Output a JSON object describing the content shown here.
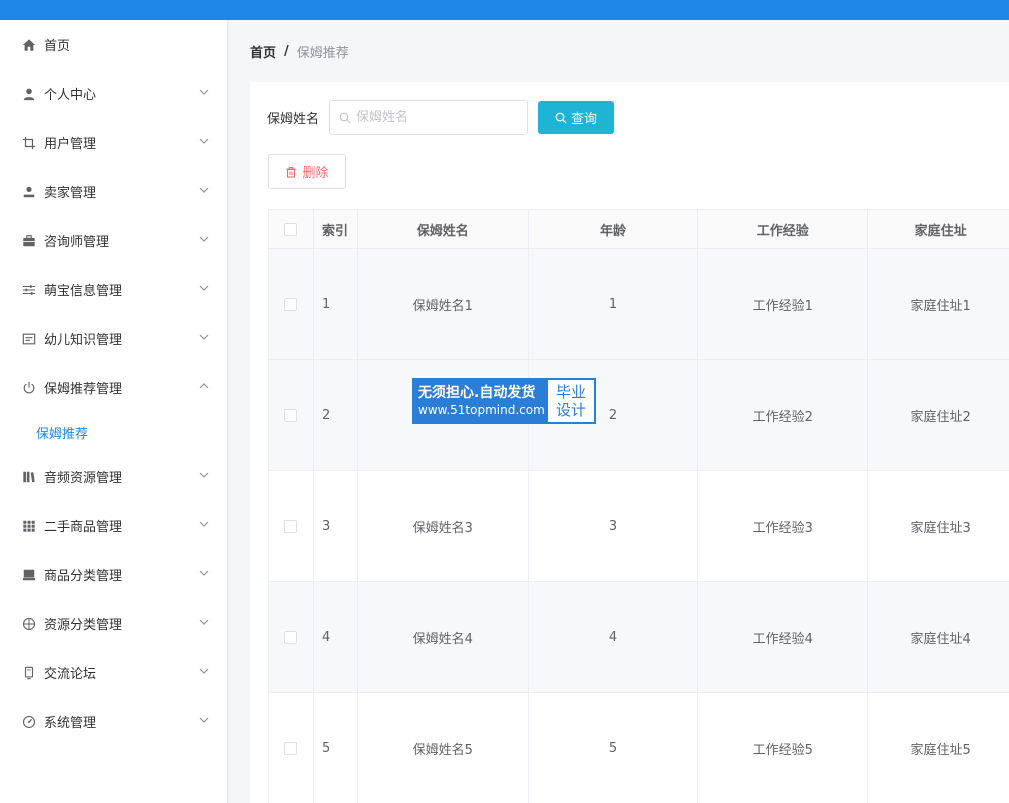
{
  "colors": {
    "topbar": "#1e86e6",
    "accent": "#1e86e6",
    "query_button": "#1fb3d6",
    "danger": "#f56c6c"
  },
  "sidebar": {
    "items": [
      {
        "label": "首页",
        "icon": "home-icon",
        "has_arrow": false
      },
      {
        "label": "个人中心",
        "icon": "user-icon",
        "has_arrow": true
      },
      {
        "label": "用户管理",
        "icon": "crop-icon",
        "has_arrow": true
      },
      {
        "label": "卖家管理",
        "icon": "person-icon",
        "has_arrow": true
      },
      {
        "label": "咨询师管理",
        "icon": "briefcase-icon",
        "has_arrow": true
      },
      {
        "label": "萌宝信息管理",
        "icon": "sliders-icon",
        "has_arrow": true
      },
      {
        "label": "幼儿知识管理",
        "icon": "card-icon",
        "has_arrow": true
      },
      {
        "label": "保姆推荐管理",
        "icon": "power-icon",
        "has_arrow": true,
        "expanded": true
      },
      {
        "label": "音频资源管理",
        "icon": "bars-icon",
        "has_arrow": true
      },
      {
        "label": "二手商品管理",
        "icon": "grid-icon",
        "has_arrow": true
      },
      {
        "label": "商品分类管理",
        "icon": "drawer-icon",
        "has_arrow": true
      },
      {
        "label": "资源分类管理",
        "icon": "globe-icon",
        "has_arrow": true
      },
      {
        "label": "交流论坛",
        "icon": "phone-icon",
        "has_arrow": true
      },
      {
        "label": "系统管理",
        "icon": "gauge-icon",
        "has_arrow": true
      }
    ],
    "submenu": {
      "label": "保姆推荐"
    }
  },
  "breadcrumb": {
    "home": "首页",
    "separator": "/",
    "current": "保姆推荐"
  },
  "search": {
    "label": "保姆姓名",
    "placeholder": "保姆姓名",
    "value": "",
    "query_label": "查询"
  },
  "toolbar": {
    "delete_label": "删除"
  },
  "table": {
    "headers": [
      "索引",
      "保姆姓名",
      "年龄",
      "工作经验",
      "家庭住址"
    ],
    "rows": [
      {
        "index": "1",
        "name": "保姆姓名1",
        "age": "1",
        "experience": "工作经验1",
        "address": "家庭住址1"
      },
      {
        "index": "2",
        "name": "",
        "age": "2",
        "experience": "工作经验2",
        "address": "家庭住址2"
      },
      {
        "index": "3",
        "name": "保姆姓名3",
        "age": "3",
        "experience": "工作经验3",
        "address": "家庭住址3"
      },
      {
        "index": "4",
        "name": "保姆姓名4",
        "age": "4",
        "experience": "工作经验4",
        "address": "家庭住址4"
      },
      {
        "index": "5",
        "name": "保姆姓名5",
        "age": "5",
        "experience": "工作经验5",
        "address": "家庭住址5"
      }
    ]
  },
  "watermark": {
    "line1": "无须担心.自动发货",
    "line2": "www.51topmind.com",
    "right1": "毕业",
    "right2": "设计"
  }
}
